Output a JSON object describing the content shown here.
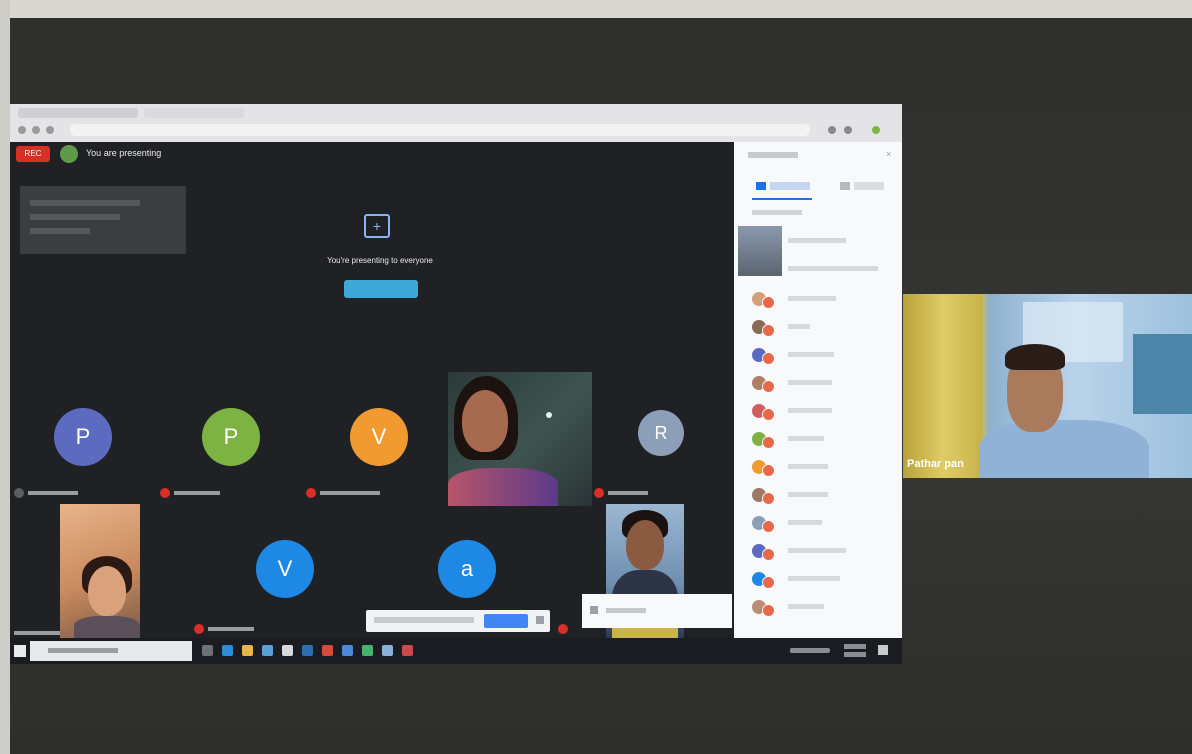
{
  "meeting": {
    "presenting_label": "You are presenting",
    "recording_badge": "REC",
    "presenting_message": "You're presenting to everyone"
  },
  "participants": [
    {
      "initial": "P",
      "color": "#5c6bc0"
    },
    {
      "initial": "P",
      "color": "#7cb342"
    },
    {
      "initial": "V",
      "color": "#f09a2f"
    },
    {
      "initial": "R",
      "color": "#8d9fb8"
    },
    {
      "initial": "V",
      "color": "#1e88e5"
    },
    {
      "initial": "a",
      "color": "#1e88e5"
    }
  ],
  "speaker": {
    "name": "Pathar pan"
  }
}
